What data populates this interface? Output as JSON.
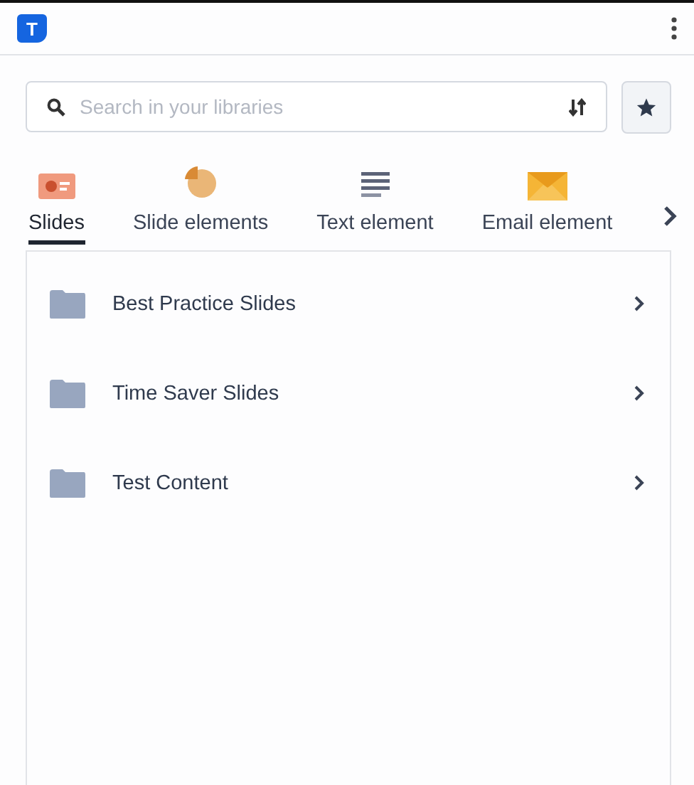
{
  "header": {
    "logo": "T"
  },
  "search": {
    "placeholder": "Search in your libraries"
  },
  "tabs": [
    {
      "kind": "slides",
      "label": "Slides",
      "selected": true
    },
    {
      "kind": "chart",
      "label": "Slide elements",
      "selected": false
    },
    {
      "kind": "text",
      "label": "Text element",
      "selected": false
    },
    {
      "kind": "email",
      "label": "Email element",
      "selected": false
    }
  ],
  "folders": [
    {
      "name": "Best Practice Slides"
    },
    {
      "name": "Time Saver Slides"
    },
    {
      "name": "Test Content"
    }
  ]
}
